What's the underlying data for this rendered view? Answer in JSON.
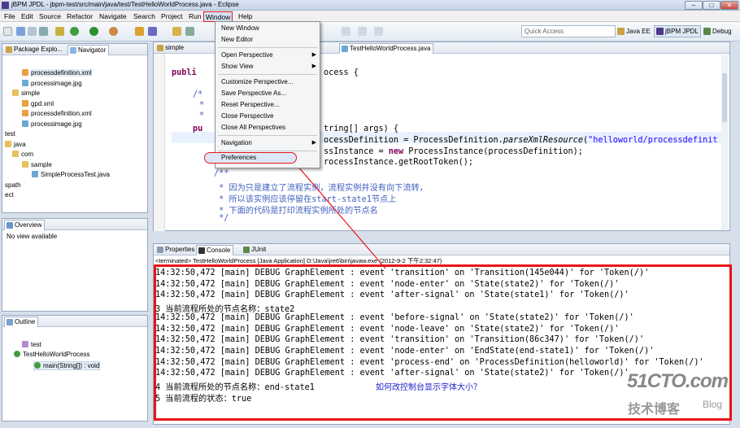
{
  "window": {
    "title": "jBPM JPDL - jbpm-test/src/main/java/test/TestHelloWorldProcess.java - Eclipse",
    "min": "–",
    "max": "□",
    "close": "✕"
  },
  "menubar": [
    "File",
    "Edit",
    "Source",
    "Refactor",
    "Navigate",
    "Search",
    "Project",
    "Run",
    "Window",
    "Help"
  ],
  "toolbar": {
    "quick_access": "Quick Access",
    "perspectives": [
      "Java EE",
      "jBPM JPDL",
      "Debug"
    ]
  },
  "explorer": {
    "tabs": [
      "Package Explo...",
      "Navigator"
    ],
    "items": [
      "processdefinition.xml",
      "processimage.jpg",
      "simple",
      "gpd.xml",
      "processdefinition.xml",
      "processimage.jpg",
      "test",
      "java",
      "com",
      "sample",
      "SimpleProcessTest.java",
      "spath",
      "ect"
    ]
  },
  "overview": {
    "tab": "Overview",
    "empty": "No view available"
  },
  "outline": {
    "tab": "Outline",
    "items": [
      "test",
      "TestHelloWorldProcess",
      "main(String[]) : void"
    ]
  },
  "editor": {
    "tabs": [
      "simple",
      "TestHelloWorldProcess.java"
    ],
    "lines": {
      "l1a": "publi",
      "l1b": "ocess {",
      "l2": "/*",
      "l3": "*",
      "l4": "*",
      "l5a": "pu",
      "l5b": "tring[] args) {",
      "l6a": "ocessDefinition = ProcessDefinition.",
      "l6b": "parseXmlResource",
      "l6c": "(",
      "l6d": "\"helloworld/processdefinit",
      "l7a": "ssInstance = ",
      "l7b": "new",
      "l7c": " ProcessInstance(processDefinition);",
      "l8": "rocessInstance.getRootToken();",
      "l9": "/**",
      "c1": " * 因为只是建立了流程实例，流程实例并没有向下流转，",
      "c2": " * 所以该实例应该停留在start-state1节点上",
      "c3": " * 下面的代码是打印流程实例所处的节点名",
      "c4": " */"
    }
  },
  "console": {
    "tabs": [
      "Properties",
      "Console",
      "JUnit"
    ],
    "header": "<terminated> TestHelloWorldProcess [Java Application] D:\\Java\\jre6\\bin\\javaw.exe (2012-9-2 下午2:32:47)",
    "lines": [
      "14:32:50,472 [main] DEBUG GraphElement : event 'transition' on 'Transition(145e044)' for 'Token(/)'",
      "14:32:50,472 [main] DEBUG GraphElement : event 'node-enter' on 'State(state2)' for 'Token(/)'",
      "14:32:50,472 [main] DEBUG GraphElement : event 'after-signal' on 'State(state1)' for 'Token(/)'",
      "3 当前流程所处的节点名称：state2",
      "14:32:50,472 [main] DEBUG GraphElement : event 'before-signal' on 'State(state2)' for 'Token(/)'",
      "14:32:50,472 [main] DEBUG GraphElement : event 'node-leave' on 'State(state2)' for 'Token(/)'",
      "14:32:50,472 [main] DEBUG GraphElement : event 'transition' on 'Transition(86c347)' for 'Token(/)'",
      "14:32:50,472 [main] DEBUG GraphElement : event 'node-enter' on 'EndState(end-state1)' for 'Token(/)'",
      "14:32:50,472 [main] DEBUG GraphElement : event 'process-end' on 'ProcessDefinition(helloworld)' for 'Token(/)'",
      "14:32:50,472 [main] DEBUG GraphElement : event 'after-signal' on 'State(state2)' for 'Token(/)'",
      "4 当前流程所处的节点名称：end-state1",
      "5 当前流程的状态：true"
    ],
    "annotation": "如何改控制台显示字体大小？"
  },
  "window_menu": {
    "items": [
      "New Window",
      "New Editor",
      "Open Perspective",
      "Show View",
      "Customize Perspective...",
      "Save Perspective As...",
      "Reset Perspective...",
      "Close Perspective",
      "Close All Perspectives",
      "Navigation",
      "Preferences"
    ]
  },
  "watermark": {
    "site": "51CTO.com",
    "sub": "技术博客",
    "blog": "Blog"
  },
  "colors": {
    "highlight_box": "#e8141a",
    "annotation": "#2222cc",
    "menu_active": "#d3e1f4"
  }
}
